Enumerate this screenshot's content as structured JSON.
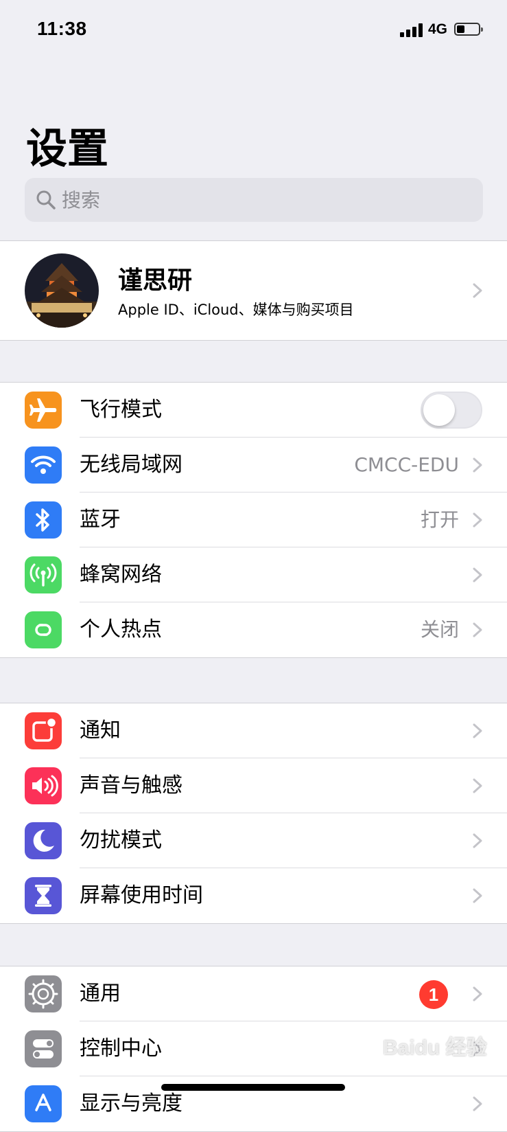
{
  "status_bar": {
    "time": "11:38",
    "network": "4G"
  },
  "page": {
    "title": "设置"
  },
  "search": {
    "placeholder": "搜索"
  },
  "profile": {
    "name": "谨思研",
    "subtitle": "Apple ID、iCloud、媒体与购买项目"
  },
  "groups": [
    {
      "items": [
        {
          "label": "飞行模式",
          "icon": "airplane-icon",
          "color": "#f7931e",
          "toggle": false
        },
        {
          "label": "无线局域网",
          "icon": "wifi-icon",
          "color": "#2f7cf6",
          "value": "CMCC-EDU"
        },
        {
          "label": "蓝牙",
          "icon": "bluetooth-icon",
          "color": "#2f7cf6",
          "value": "打开"
        },
        {
          "label": "蜂窝网络",
          "icon": "cellular-icon",
          "color": "#4cd964"
        },
        {
          "label": "个人热点",
          "icon": "hotspot-icon",
          "color": "#4cd964",
          "value": "关闭"
        }
      ]
    },
    {
      "items": [
        {
          "label": "通知",
          "icon": "notification-icon",
          "color": "#fc3d39"
        },
        {
          "label": "声音与触感",
          "icon": "sound-icon",
          "color": "#fc3158"
        },
        {
          "label": "勿扰模式",
          "icon": "moon-icon",
          "color": "#5856d6"
        },
        {
          "label": "屏幕使用时间",
          "icon": "hourglass-icon",
          "color": "#5856d6"
        }
      ]
    },
    {
      "items": [
        {
          "label": "通用",
          "icon": "gear-icon",
          "color": "#8e8e93",
          "badge": "1"
        },
        {
          "label": "控制中心",
          "icon": "control-center-icon",
          "color": "#8e8e93"
        },
        {
          "label": "显示与亮度",
          "icon": "display-icon",
          "color": "#2f7cf6"
        }
      ]
    }
  ],
  "watermark": "Baidu 经验"
}
